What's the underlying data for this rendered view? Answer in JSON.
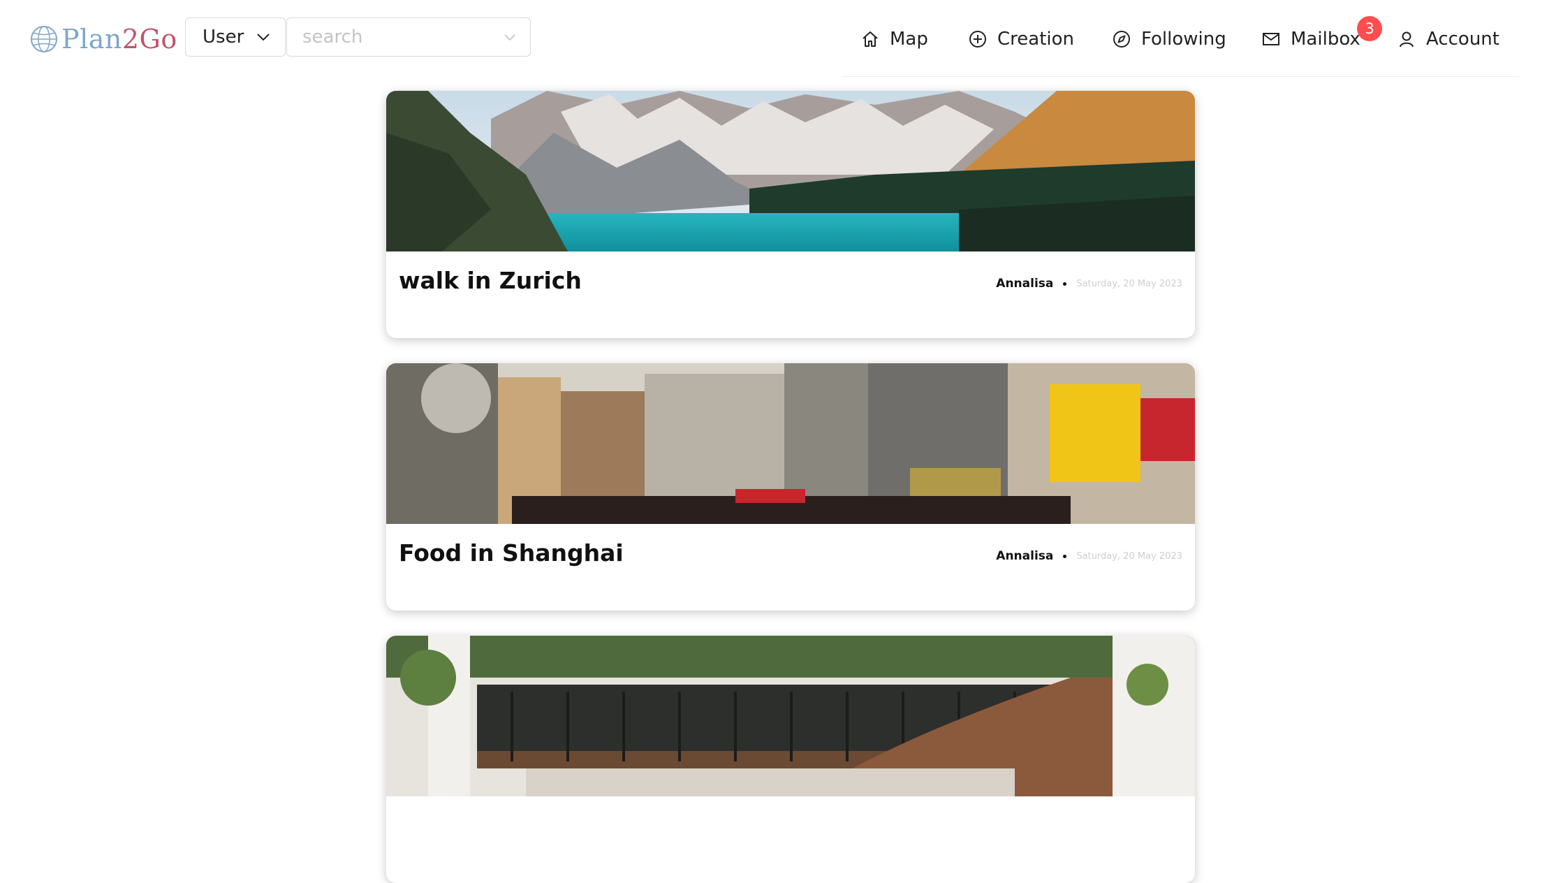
{
  "header": {
    "logo": {
      "prefix": "Plan",
      "middle": "2",
      "suffix": "Go"
    },
    "type_select": {
      "value": "User"
    },
    "search": {
      "placeholder": "search"
    },
    "nav": [
      {
        "label": "Map",
        "icon": "home-icon"
      },
      {
        "label": "Creation",
        "icon": "plus-circle-icon"
      },
      {
        "label": "Following",
        "icon": "compass-icon"
      },
      {
        "label": "Mailbox",
        "icon": "mail-icon"
      },
      {
        "label": "Account",
        "icon": "user-icon"
      }
    ],
    "mailbox_badge": "3"
  },
  "posts": [
    {
      "title": "walk in Zurich",
      "author": "Annalisa",
      "date": "Saturday, 20 May 2023",
      "image": "mountain-lake-photo"
    },
    {
      "title": "Food in Shanghai",
      "author": "Annalisa",
      "date": "Saturday, 20 May 2023",
      "image": "shanghai-street-photo"
    },
    {
      "title": "",
      "author": "",
      "date": "",
      "image": "plant-balcony-photo"
    }
  ],
  "colors": {
    "accent_blue": "#7fa7c9",
    "accent_red": "#c0546e",
    "badge": "#ff4d4f"
  }
}
